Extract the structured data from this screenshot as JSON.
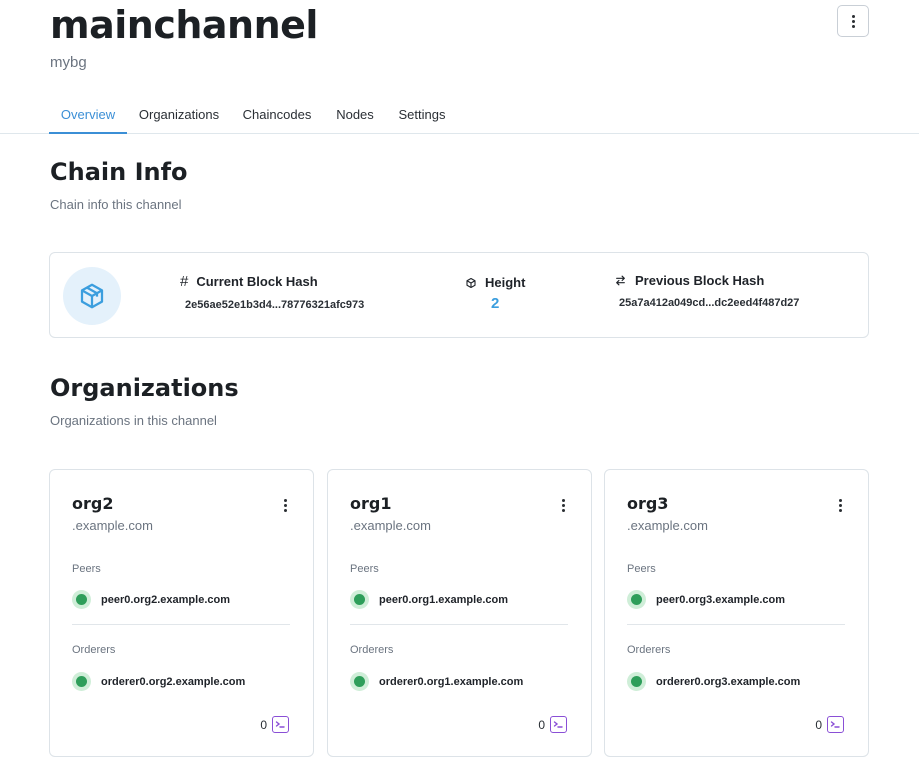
{
  "channel": {
    "name": "mainchannel",
    "subtitle": "mybg"
  },
  "tabs": [
    {
      "label": "Overview",
      "active": true
    },
    {
      "label": "Organizations",
      "active": false
    },
    {
      "label": "Chaincodes",
      "active": false
    },
    {
      "label": "Nodes",
      "active": false
    },
    {
      "label": "Settings",
      "active": false
    }
  ],
  "chain_info": {
    "title": "Chain Info",
    "subtitle": "Chain info this channel",
    "current_hash_label": "Current Block Hash",
    "current_hash_value": "2e56ae52e1b3d4...78776321afc973",
    "height_label": "Height",
    "height_value": "2",
    "previous_hash_label": "Previous Block Hash",
    "previous_hash_value": "25a7a412a049cd...dc2eed4f487d27"
  },
  "organizations": {
    "title": "Organizations",
    "subtitle": "Organizations in this channel",
    "peers_label": "Peers",
    "orderers_label": "Orderers",
    "items": [
      {
        "name": "org2",
        "domain": ".example.com",
        "peer": "peer0.org2.example.com",
        "orderer": "orderer0.org2.example.com",
        "chaincode_count": "0"
      },
      {
        "name": "org1",
        "domain": ".example.com",
        "peer": "peer0.org1.example.com",
        "orderer": "orderer0.org1.example.com",
        "chaincode_count": "0"
      },
      {
        "name": "org3",
        "domain": ".example.com",
        "peer": "peer0.org3.example.com",
        "orderer": "orderer0.org3.example.com",
        "chaincode_count": "0"
      }
    ]
  },
  "icons": {
    "menu": "more-vertical-icon",
    "cube": "cube-icon",
    "hash": "hash-icon",
    "height": "box-icon",
    "previous": "swap-icon",
    "status": "status-online-icon",
    "terminal": "terminal-icon"
  },
  "colors": {
    "accent": "#3b8fd6",
    "height_value": "#3b9ede",
    "status_online": "#2e9e5a",
    "terminal": "#8a4fd6"
  }
}
